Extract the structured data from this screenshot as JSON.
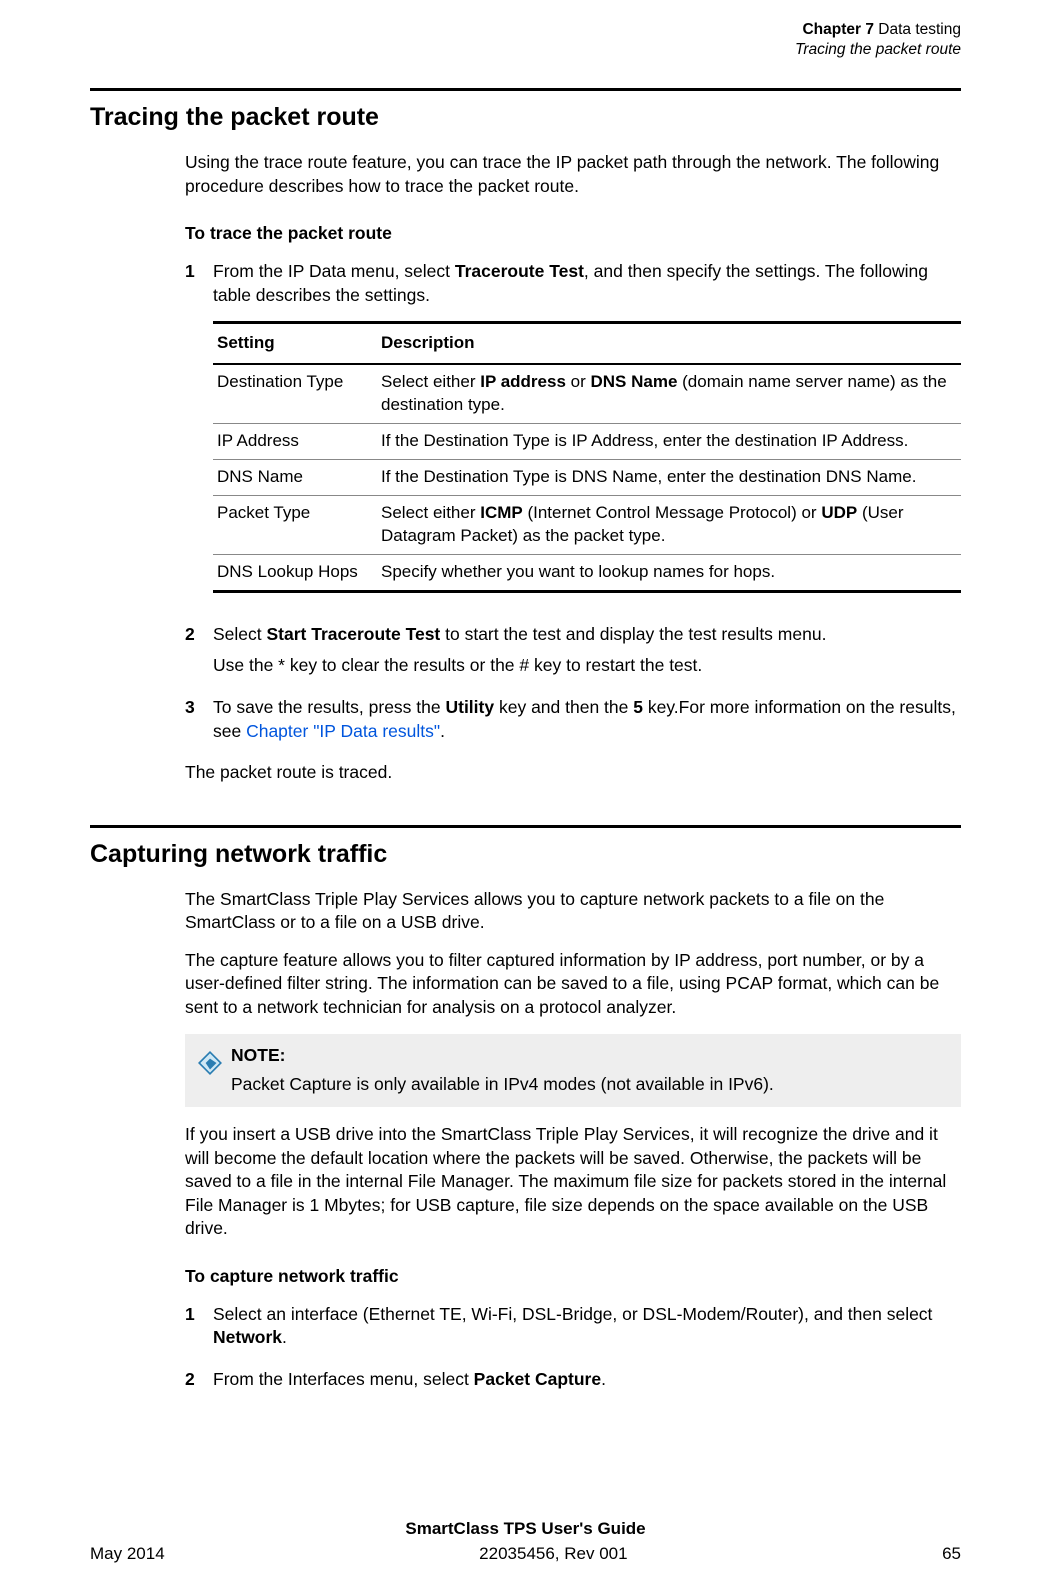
{
  "header": {
    "chapter_label": "Chapter 7",
    "chapter_title": "Data testing",
    "section_title": "Tracing the packet route"
  },
  "section1": {
    "heading": "Tracing the packet route",
    "intro": "Using the trace route feature, you can trace the IP packet path through the network. The following procedure describes how to trace the packet route.",
    "sub_heading": "To trace the packet route",
    "step1": {
      "num": "1",
      "text_a": "From the IP Data menu, select ",
      "bold_a": "Traceroute Test",
      "text_b": ", and then specify the settings. The following table describes the settings."
    },
    "table": {
      "headers": {
        "c1": "Setting",
        "c2": "Description"
      },
      "rows": [
        {
          "c1": "Destination Type",
          "c2_a": "Select either ",
          "b1": "IP address",
          "c2_b": " or ",
          "b2": "DNS Name",
          "c2_c": " (domain name server name) as the destination type."
        },
        {
          "c1": "IP Address",
          "c2": "If the Destination Type is IP Address, enter the destination IP Address."
        },
        {
          "c1": "DNS Name",
          "c2": "If the Destination Type is DNS Name, enter the destination DNS Name."
        },
        {
          "c1": "Packet Type",
          "c2_a": "Select either ",
          "b1": "ICMP",
          "c2_b": " (Internet Control Message Protocol) or ",
          "b2": "UDP",
          "c2_c": " (User Datagram Packet) as the packet type."
        },
        {
          "c1": "DNS Lookup Hops",
          "c2": "Specify whether you want to lookup names for hops."
        }
      ]
    },
    "step2": {
      "num": "2",
      "text_a": "Select ",
      "bold_a": "Start Traceroute Test",
      "text_b": " to start the test and display the test results menu.",
      "sub": "Use the * key to clear the results or the # key to restart the test."
    },
    "step3": {
      "num": "3",
      "text_a": "To save the results, press the ",
      "bold_a": "Utility",
      "text_b": " key and then the ",
      "bold_b": "5",
      "text_c": " key.For more information on the results, see ",
      "link": "Chapter  \"IP Data results\"",
      "text_d": "."
    },
    "closing": "The packet route is traced."
  },
  "section2": {
    "heading": "Capturing network traffic",
    "para1": "The SmartClass Triple Play Services allows you to capture network packets to a file on the SmartClass or to a file on a USB drive.",
    "para2": "The capture feature allows you to filter captured information by IP address, port number, or by a user-defined filter string. The information can be saved to a file, using PCAP format, which can be sent to a network technician for analysis on a protocol analyzer.",
    "note": {
      "title": "NOTE:",
      "body": "Packet Capture is only available in IPv4 modes (not available in IPv6)."
    },
    "para3": "If you insert a USB drive into the SmartClass Triple Play Services, it will recognize the drive and it will become the default location where the packets will be saved. Otherwise, the packets will be saved to a file in the internal File Manager. The maximum file size for packets stored in the internal File Manager is 1 Mbytes; for USB capture, file size depends on the space available on the USB drive.",
    "sub_heading": "To capture network traffic",
    "step1": {
      "num": "1",
      "text_a": "Select an interface (Ethernet TE, Wi-Fi, DSL-Bridge, or DSL-Modem/Router), and then select ",
      "bold_a": "Network",
      "text_b": "."
    },
    "step2": {
      "num": "2",
      "text_a": "From the Interfaces menu, select ",
      "bold_a": "Packet Capture",
      "text_b": "."
    }
  },
  "footer": {
    "title": "SmartClass TPS User's Guide",
    "left": "May 2014",
    "center": "22035456, Rev 001",
    "right": "65"
  }
}
